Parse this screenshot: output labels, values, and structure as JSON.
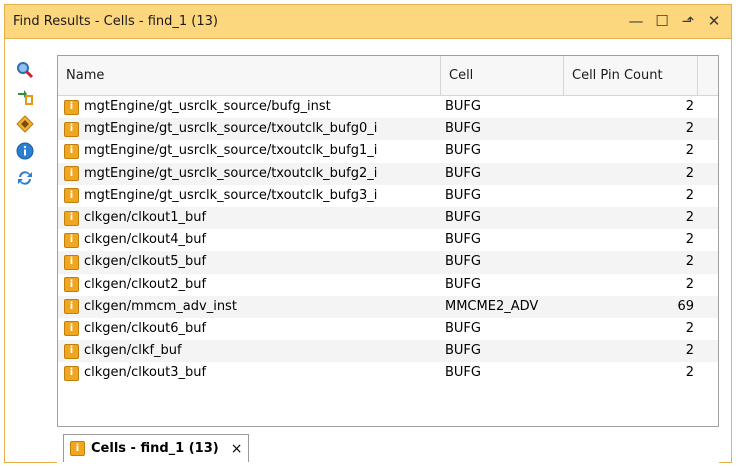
{
  "window": {
    "title": "Find Results - Cells - find_1 (13)",
    "controls": {
      "minimize": "—",
      "maximize": "☐",
      "float": "⬏",
      "close": "✕"
    }
  },
  "toolbar": {
    "icons": [
      "search-icon",
      "expand-icon",
      "properties-icon",
      "info-icon",
      "refresh-icon"
    ]
  },
  "table": {
    "columns": [
      "Name",
      "Cell",
      "Cell Pin Count"
    ],
    "rows": [
      {
        "icon": "i",
        "name": "mgtEngine/gt_usrclk_source/bufg_inst",
        "cell": "BUFG",
        "count": "2"
      },
      {
        "icon": "i",
        "name": "mgtEngine/gt_usrclk_source/txoutclk_bufg0_i",
        "cell": "BUFG",
        "count": "2"
      },
      {
        "icon": "i",
        "name": "mgtEngine/gt_usrclk_source/txoutclk_bufg1_i",
        "cell": "BUFG",
        "count": "2"
      },
      {
        "icon": "i",
        "name": "mgtEngine/gt_usrclk_source/txoutclk_bufg2_i",
        "cell": "BUFG",
        "count": "2"
      },
      {
        "icon": "i",
        "name": "mgtEngine/gt_usrclk_source/txoutclk_bufg3_i",
        "cell": "BUFG",
        "count": "2"
      },
      {
        "icon": "i",
        "name": "clkgen/clkout1_buf",
        "cell": "BUFG",
        "count": "2"
      },
      {
        "icon": "i",
        "name": "clkgen/clkout4_buf",
        "cell": "BUFG",
        "count": "2"
      },
      {
        "icon": "i",
        "name": "clkgen/clkout5_buf",
        "cell": "BUFG",
        "count": "2"
      },
      {
        "icon": "i",
        "name": "clkgen/clkout2_buf",
        "cell": "BUFG",
        "count": "2"
      },
      {
        "icon": "i",
        "name": "clkgen/mmcm_adv_inst",
        "cell": "MMCME2_ADV",
        "count": "69"
      },
      {
        "icon": "i",
        "name": "clkgen/clkout6_buf",
        "cell": "BUFG",
        "count": "2"
      },
      {
        "icon": "i",
        "name": "clkgen/clkf_buf",
        "cell": "BUFG",
        "count": "2"
      },
      {
        "icon": "i",
        "name": "clkgen/clkout3_buf",
        "cell": "BUFG",
        "count": "2"
      }
    ]
  },
  "tabs": [
    {
      "icon": "i",
      "label": "Cells - find_1 (13)",
      "close": "×"
    }
  ],
  "colors": {
    "titlebar": "#fcd77e",
    "accent_icon": "#f0a620"
  }
}
